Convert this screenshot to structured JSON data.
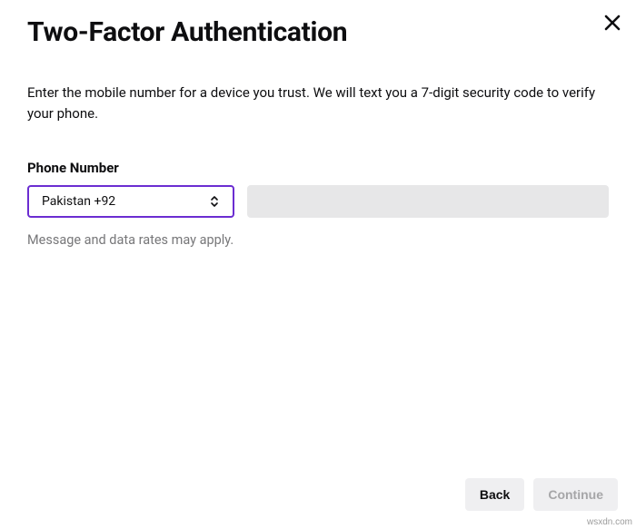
{
  "header": {
    "title": "Two-Factor Authentication"
  },
  "body": {
    "description": "Enter the mobile number for a device you trust. We will text you a 7-digit security code to verify your phone.",
    "field_label": "Phone Number",
    "country_selected": "Pakistan +92",
    "phone_value": "",
    "helper_text": "Message and data rates may apply."
  },
  "footer": {
    "back_label": "Back",
    "continue_label": "Continue"
  },
  "watermark": "wsxdn.com"
}
